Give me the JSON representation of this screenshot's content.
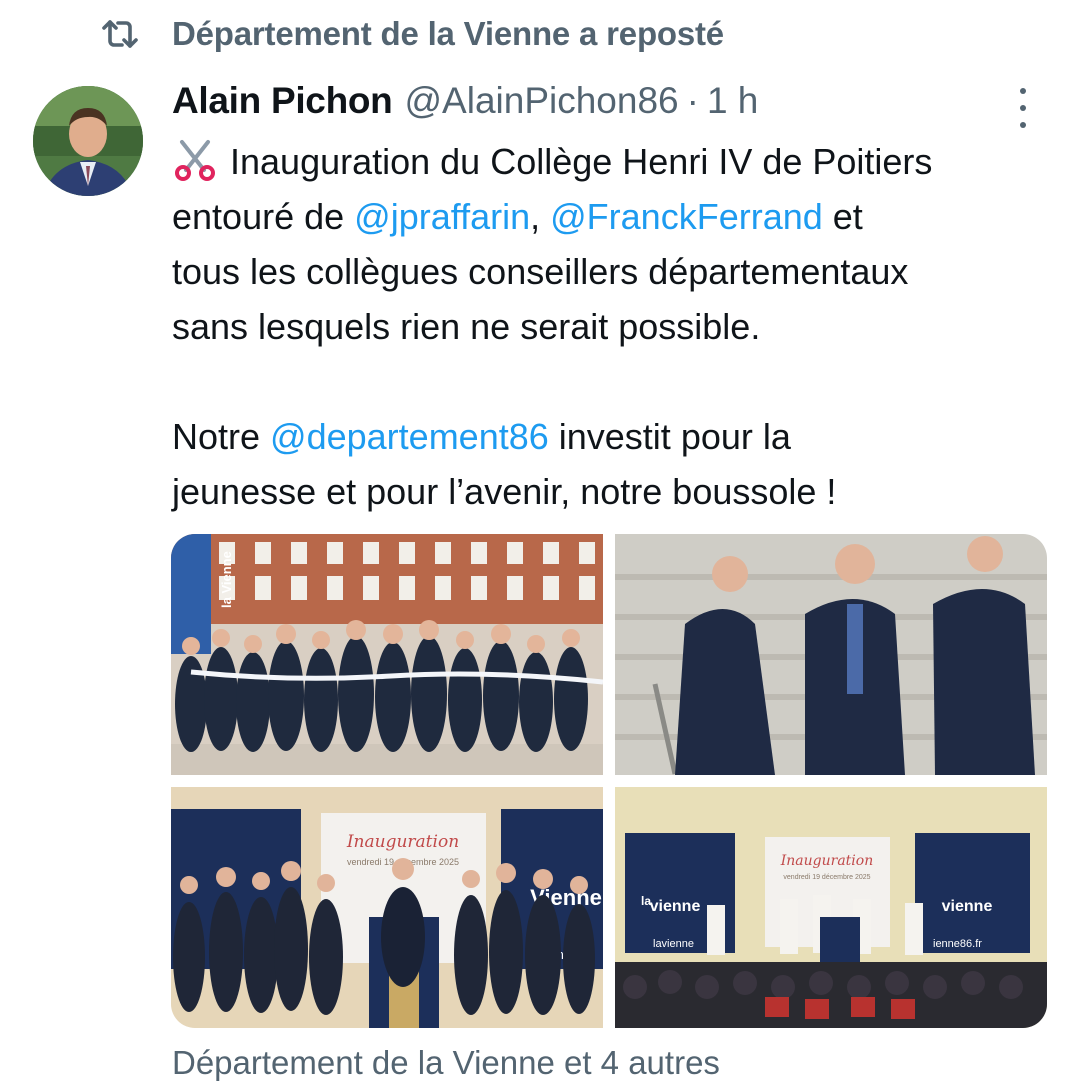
{
  "repost": {
    "icon": "repost-icon",
    "text": "Département de la Vienne a reposté"
  },
  "tweet": {
    "author": {
      "name": "Alain Pichon",
      "handle": "@AlainPichon86",
      "avatar": "avatar-photo"
    },
    "separator": "·",
    "time": "1 h",
    "more_icon": "more-vertical-icon",
    "body": {
      "emoji": "scissors-icon",
      "line1": "Inauguration du Collège Henri IV de Poitiers",
      "line2_before": "entouré de ",
      "mention_1": "@jpraffarin",
      "line2_comma": ", ",
      "mention_2": "@FranckFerrand",
      "line2_after": " et",
      "line3": "tous les collègues conseillers départementaux",
      "line4": "sans lesquels rien ne serait possible.",
      "line5_before": "Notre ",
      "mention_3": "@departement86",
      "line5_after": " investit pour la",
      "line6": "jeunesse et pour l’avenir, notre boussole !"
    },
    "media": {
      "photo_1": {
        "banner_text": "la Vienne"
      },
      "photo_3": {
        "sign_title": "Inauguration",
        "sign_subtitle": "vendredi 19 décembre 2025",
        "banner_text": "Vienne",
        "banner_url": "ienne8"
      },
      "photo_4": {
        "sign_title": "Inauguration",
        "sign_subtitle": "vendredi 19 décembre 2025",
        "banner_text": "vienne",
        "banner_brand": "la",
        "banner_url_left": "lavienne",
        "banner_url_right": "ienne86.fr"
      }
    },
    "social_context": "Département de la Vienne et 4 autres"
  },
  "colors": {
    "text_primary": "#0f1419",
    "text_secondary": "#536471",
    "mention": "#1d9bf0",
    "vienne_blue": "#1c2f5a"
  }
}
